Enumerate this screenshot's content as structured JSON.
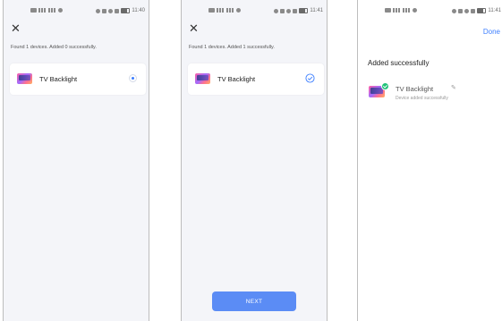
{
  "screens": [
    {
      "status_time": "11:40",
      "close_glyph": "✕",
      "summary": "Found 1 devices. Added 0 successfully.",
      "device_name": "TV Backlight",
      "state_icon": "radio-selected-icon"
    },
    {
      "status_time": "11:41",
      "close_glyph": "✕",
      "summary": "Found 1 devices. Added 1 successfully.",
      "device_name": "TV Backlight",
      "state_icon": "check-circle-icon",
      "next_label": "NEXT"
    },
    {
      "status_time": "11:41",
      "done_label": "Done",
      "title": "Added successfully",
      "device_name": "TV Backlight",
      "device_status": "Device added successfully",
      "edit_glyph": "✎"
    }
  ],
  "colors": {
    "accent": "#3d7fff",
    "button": "#5b8cf5",
    "success": "#22c37a",
    "screen_bg": "#f4f5f9"
  }
}
